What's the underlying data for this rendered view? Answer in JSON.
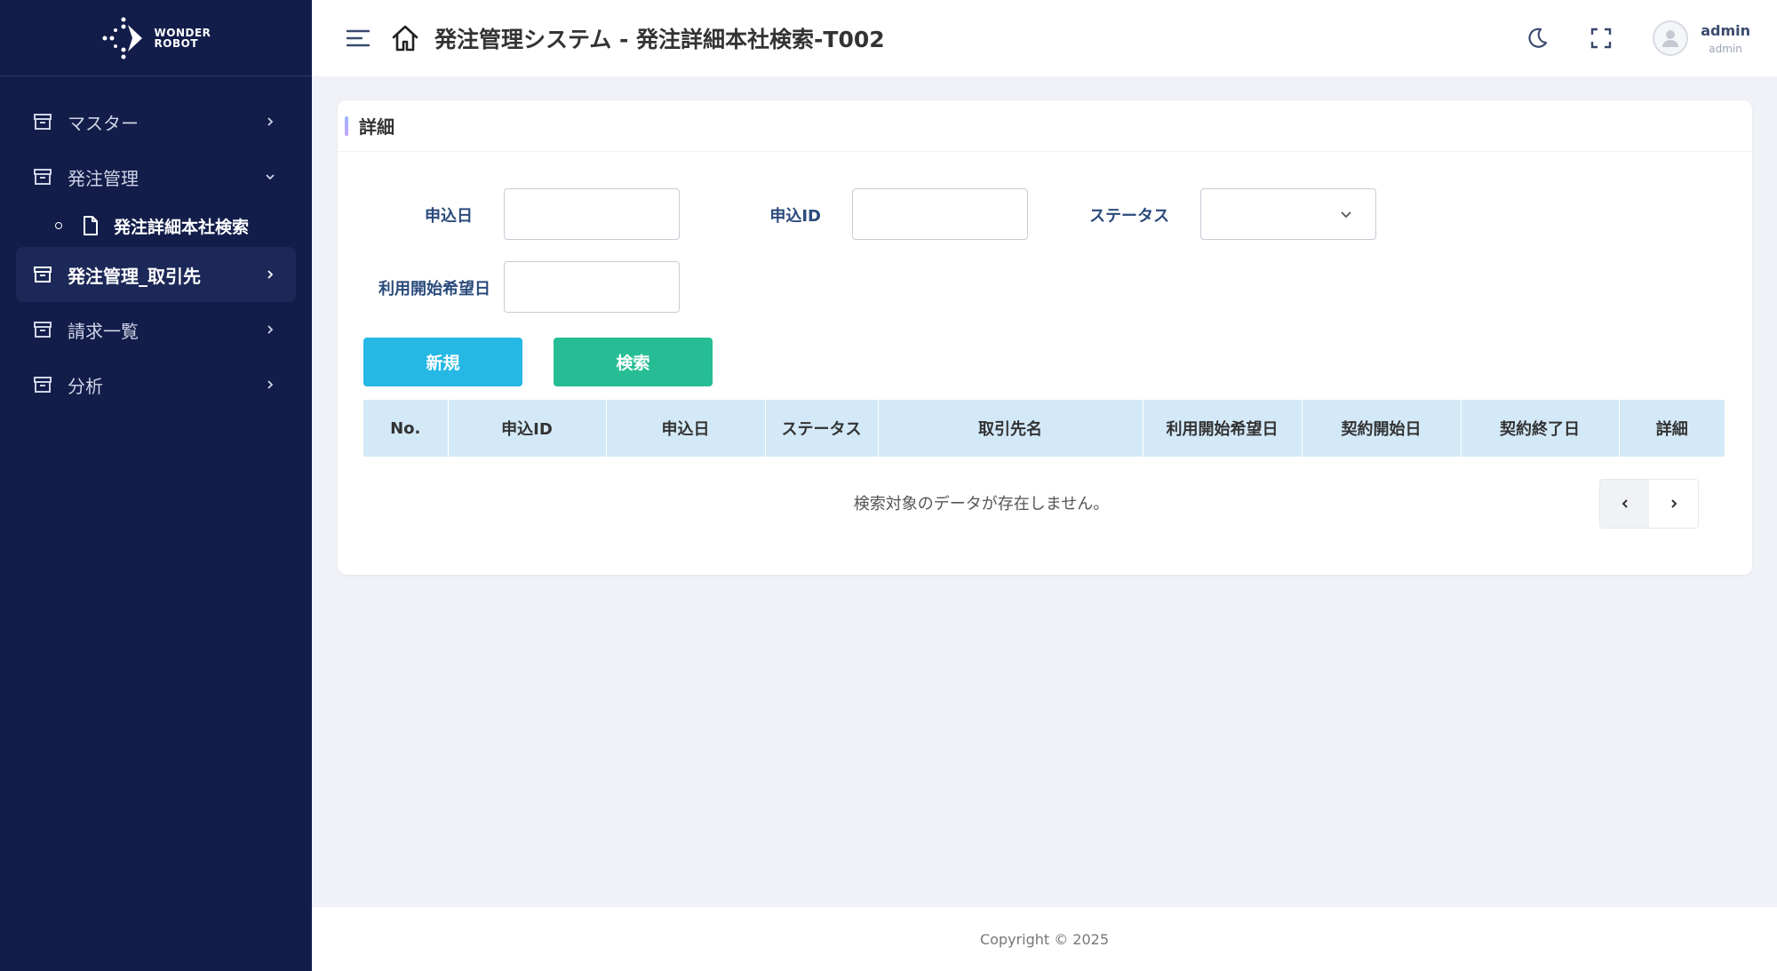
{
  "logo": {
    "line1": "WONDER",
    "line2": "ROBOT"
  },
  "sidebar": {
    "items": [
      {
        "label": "マスター"
      },
      {
        "label": "発注管理"
      },
      {
        "label": "発注管理_取引先"
      },
      {
        "label": "請求一覧"
      },
      {
        "label": "分析"
      }
    ],
    "submenu": [
      {
        "label": "発注詳細本社検索"
      }
    ]
  },
  "header": {
    "title": "発注管理システム - 発注詳細本社検索-T002",
    "user_name": "admin",
    "user_role": "admin"
  },
  "card": {
    "title": "詳細"
  },
  "form": {
    "apply_date_label": "申込日",
    "apply_id_label": "申込ID",
    "status_label": "ステータス",
    "start_date_label": "利用開始希望日"
  },
  "buttons": {
    "new_label": "新規",
    "search_label": "検索"
  },
  "table": {
    "columns": [
      "No.",
      "申込ID",
      "申込日",
      "ステータス",
      "取引先名",
      "利用開始希望日",
      "契約開始日",
      "契約終了日",
      "詳細"
    ],
    "empty_message": "検索対象のデータが存在しません。"
  },
  "footer": {
    "copyright": "Copyright © 2025"
  },
  "colors": {
    "sidebar_bg": "#121d4a",
    "new_button": "#25b8e4",
    "search_button": "#26bd94",
    "table_header": "#d4e9f8"
  }
}
